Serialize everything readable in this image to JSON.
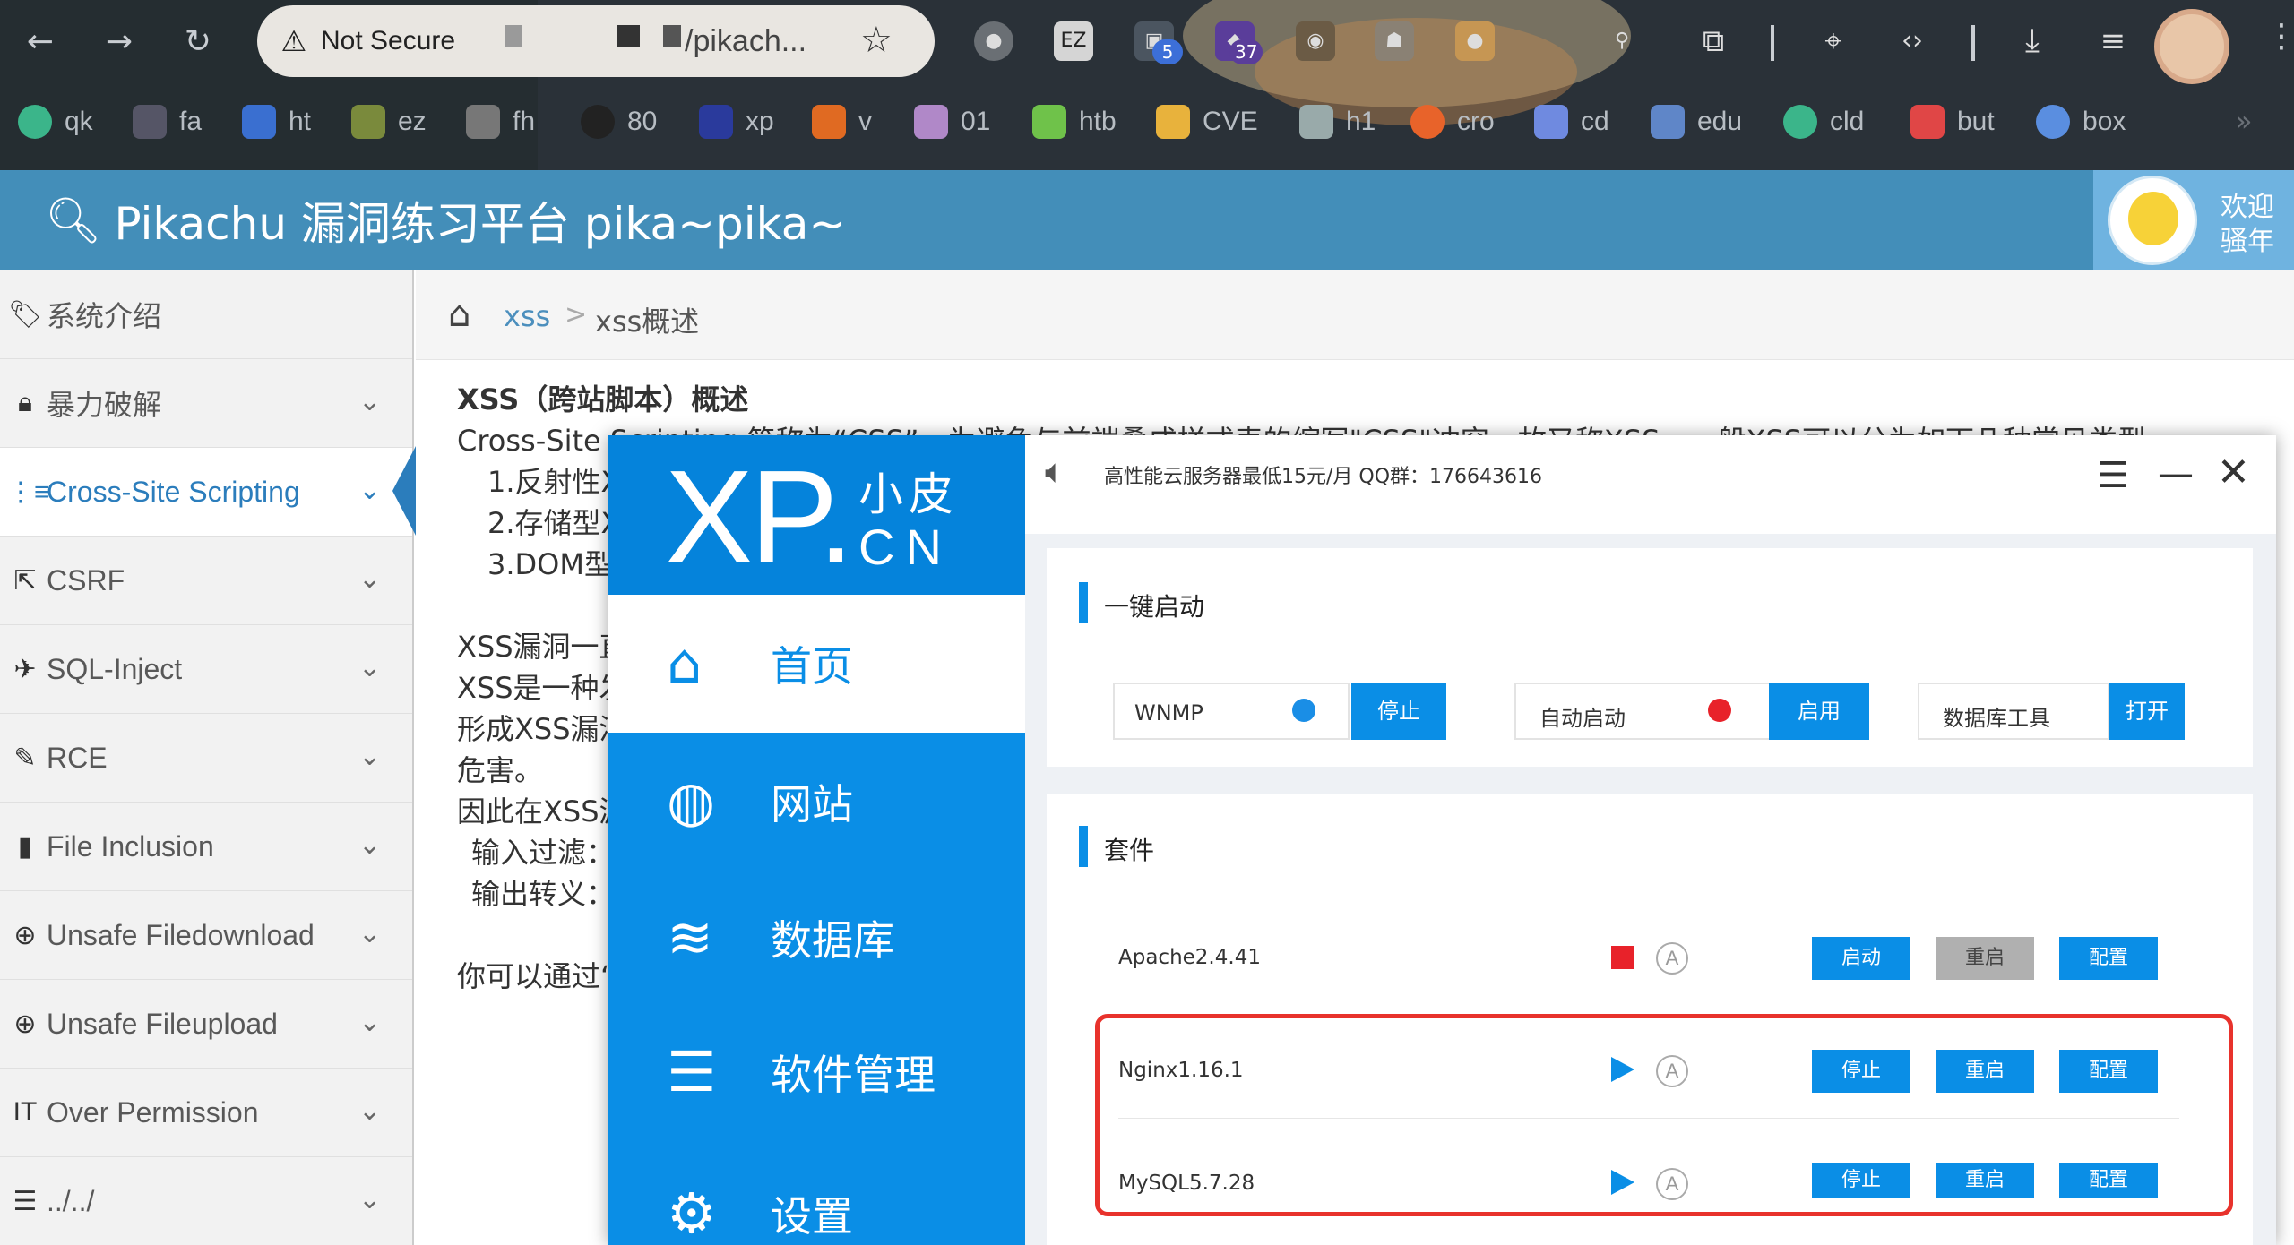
{
  "browser": {
    "security_label": "Not Secure",
    "url": "/pikach...",
    "extension_badges": [
      "5",
      "37"
    ],
    "bookmarks": [
      "qk",
      "fa",
      "ht",
      "ez",
      "fh",
      "80",
      "xp",
      "v",
      "01",
      "htb",
      "CVE",
      "h1",
      "cro",
      "cd",
      "edu",
      "cld",
      "but",
      "box"
    ]
  },
  "app": {
    "title": "Pikachu 漏洞练习平台 pika~pika~",
    "welcome_line1": "欢迎",
    "welcome_line2": "骚年"
  },
  "sidebar": {
    "items": [
      {
        "label": "系统介绍",
        "icon": "tag-icon"
      },
      {
        "label": "暴力破解",
        "icon": "lock-icon"
      },
      {
        "label": "Cross-Site Scripting",
        "icon": "list-icon"
      },
      {
        "label": "CSRF",
        "icon": "external-link-icon"
      },
      {
        "label": "SQL-Inject",
        "icon": "plane-icon"
      },
      {
        "label": "RCE",
        "icon": "pencil-icon"
      },
      {
        "label": "File Inclusion",
        "icon": "file-icon"
      },
      {
        "label": "Unsafe Filedownload",
        "icon": "download-circle-icon"
      },
      {
        "label": "Unsafe Fileupload",
        "icon": "upload-circle-icon"
      },
      {
        "label": "Over Permission",
        "icon": "text-cursor-icon"
      },
      {
        "label": "../../",
        "icon": "align-left-icon"
      }
    ]
  },
  "breadcrumb": {
    "link": "xss",
    "separator": ">",
    "current": "xss概述"
  },
  "content": {
    "heading": "XSS（跨站脚本）概述",
    "line1": "Cross-Site S",
    "line1_hidden_tail": "cripting 简称为“CSS”，为避免与前端叠成样式表的缩写\"CSS\"冲突，故又称XSS。一般XSS可以分为如下几种常见类型",
    "item1": "1.反射性X",
    "item2": "2.存储型X",
    "item3": "3.DOM型",
    "p1": "XSS漏洞一直",
    "p2": "XSS是一种发",
    "p3": "形成XSS漏洞",
    "p4": "危害。",
    "p5": "因此在XSS漏",
    "p6": "输入过滤：",
    "p7": "输出转义：",
    "p8": "你可以通过“"
  },
  "xp": {
    "logo_main": "XP.",
    "logo_sub1": "小皮",
    "logo_sub2": "CN",
    "nav": [
      {
        "label": "首页",
        "icon": "home-icon",
        "glyph": "⌂"
      },
      {
        "label": "网站",
        "icon": "globe-icon",
        "glyph": "◍"
      },
      {
        "label": "数据库",
        "icon": "database-icon",
        "glyph": "≋"
      },
      {
        "label": "软件管理",
        "icon": "sliders-icon",
        "glyph": "☰"
      },
      {
        "label": "设置",
        "icon": "gear-icon",
        "glyph": "⚙"
      }
    ],
    "notice": "高性能云服务器最低15元/月  QQ群：176643616",
    "quick_start": {
      "title": "一键启动",
      "items": [
        {
          "label": "WNMP",
          "dot_color": "#1a8ee6",
          "button": "停止"
        },
        {
          "label": "自动启动",
          "dot_color": "#e8222a",
          "button": "启用"
        },
        {
          "label": "数据库工具",
          "button": "打开"
        }
      ]
    },
    "suite": {
      "title": "套件",
      "auto_glyph": "A",
      "rows": [
        {
          "name": "Apache2.4.41",
          "status": "stopped",
          "buttons": [
            "启动",
            "重启",
            "配置"
          ]
        },
        {
          "name": "Nginx1.16.1",
          "status": "running",
          "buttons": [
            "停止",
            "重启",
            "配置"
          ]
        },
        {
          "name": "MySQL5.7.28",
          "status": "running",
          "buttons": [
            "停止",
            "重启",
            "配置"
          ]
        }
      ]
    },
    "colors": {
      "accent": "#0a8ee6",
      "stopped": "#e8222a",
      "highlight": "#e8322c"
    }
  }
}
